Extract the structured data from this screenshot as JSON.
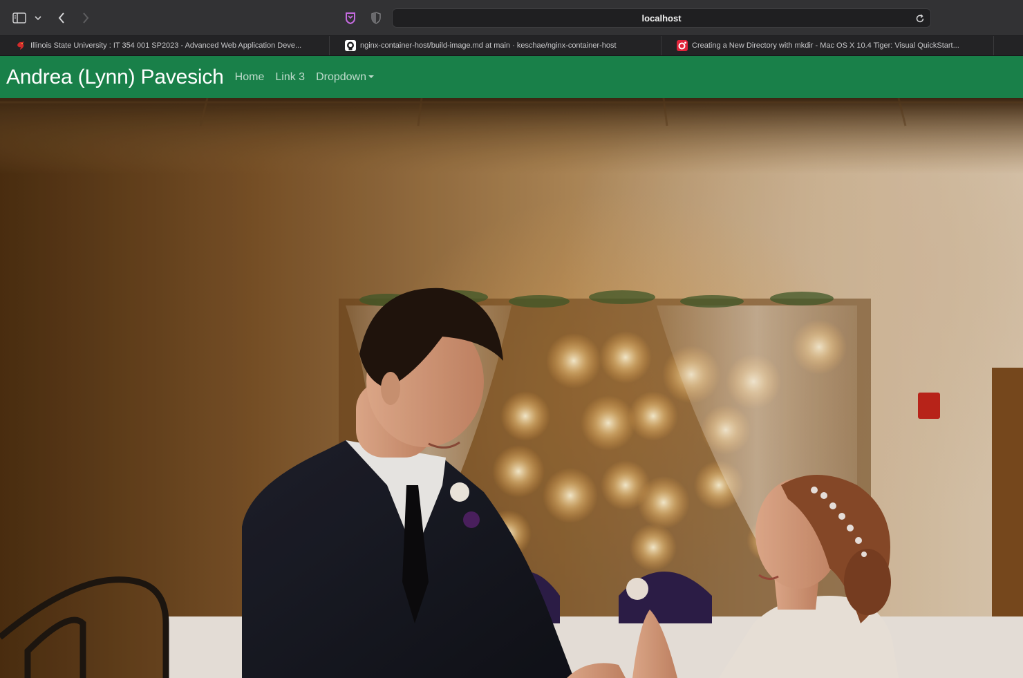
{
  "browser": {
    "address": "localhost",
    "tabs": [
      {
        "label": "Illinois State University : IT 354 001 SP2023 - Advanced Web Application Deve...",
        "icon": "isu-redbird-icon"
      },
      {
        "label": "nginx-container-host/build-image.md at main · keschae/nginx-container-host",
        "icon": "github-icon"
      },
      {
        "label": "Creating a New Directory with mkdir - Mac OS X 10.4 Tiger: Visual QuickStart...",
        "icon": "oreilly-icon"
      }
    ]
  },
  "navbar": {
    "brand": "Andrea (Lynn) Pavesich",
    "links": [
      "Home",
      "Link 3",
      "Dropdown"
    ],
    "background_color": "#198049"
  },
  "hero": {
    "image": "wedding-couple-photo"
  }
}
